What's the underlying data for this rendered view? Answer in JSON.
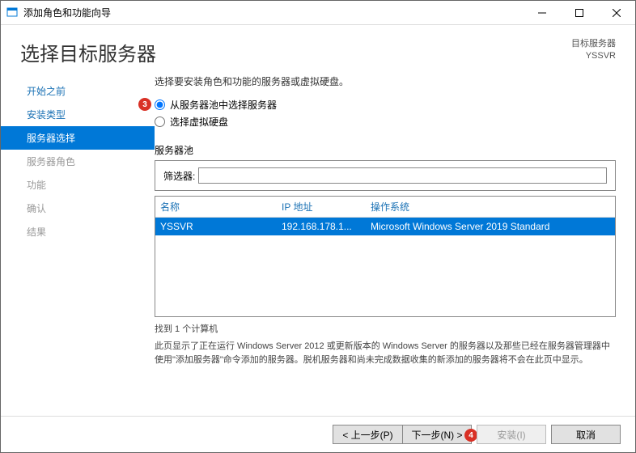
{
  "window": {
    "title": "添加角色和功能向导"
  },
  "header": {
    "title": "选择目标服务器",
    "dest_label": "目标服务器",
    "dest_value": "YSSVR"
  },
  "sidebar": {
    "steps": [
      {
        "label": "开始之前",
        "state": "link"
      },
      {
        "label": "安装类型",
        "state": "link"
      },
      {
        "label": "服务器选择",
        "state": "active"
      },
      {
        "label": "服务器角色",
        "state": "disabled"
      },
      {
        "label": "功能",
        "state": "disabled"
      },
      {
        "label": "确认",
        "state": "disabled"
      },
      {
        "label": "结果",
        "state": "disabled"
      }
    ]
  },
  "main": {
    "intro": "选择要安装角色和功能的服务器或虚拟硬盘。",
    "radios": {
      "pool": "从服务器池中选择服务器",
      "vhd": "选择虚拟硬盘",
      "selected": "pool"
    },
    "section_label": "服务器池",
    "filter_label": "筛选器:",
    "filter_value": "",
    "columns": {
      "name": "名称",
      "ip": "IP 地址",
      "os": "操作系统"
    },
    "rows": [
      {
        "name": "YSSVR",
        "ip": "192.168.178.1...",
        "os": "Microsoft Windows Server 2019 Standard"
      }
    ],
    "found_text": "找到 1 个计算机",
    "description": "此页显示了正在运行 Windows Server 2012 或更新版本的 Windows Server 的服务器以及那些已经在服务器管理器中使用\"添加服务器\"命令添加的服务器。脱机服务器和尚未完成数据收集的新添加的服务器将不会在此页中显示。"
  },
  "footer": {
    "prev": "< 上一步(P)",
    "next": "下一步(N) >",
    "install": "安装(I)",
    "cancel": "取消"
  },
  "annotations": {
    "badge3": "3",
    "badge4": "4"
  }
}
